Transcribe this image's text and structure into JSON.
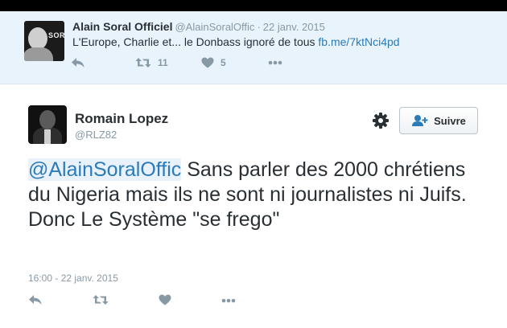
{
  "parent_tweet": {
    "avatar_brand": "SORAL",
    "name": "Alain Soral Officiel",
    "handle": "@AlainSoralOffic",
    "date": "22 janv. 2015",
    "text": "L'Europe, Charlie et... le Donbass ignoré de tous ",
    "link": "fb.me/7ktNci4pd",
    "retweet_count": "11",
    "favorite_count": "5"
  },
  "main_tweet": {
    "name": "Romain Lopez",
    "handle": "@RLZ82",
    "follow_label": "Suivre",
    "mention": "@AlainSoralOffic",
    "text": " Sans parler des 2000 chrétiens du Nigeria  mais ils ne sont ni journalistes ni Juifs. Donc Le Système \"se frego\"",
    "timestamp": "16:00 - 22 janv. 2015"
  },
  "colors": {
    "link": "#2b7bb9",
    "muted": "#8899a6",
    "parent_bg": "#e8f3fb"
  },
  "icons": [
    "reply-icon",
    "retweet-icon",
    "heart-icon",
    "more-icon",
    "gear-icon",
    "follow-user-icon"
  ]
}
